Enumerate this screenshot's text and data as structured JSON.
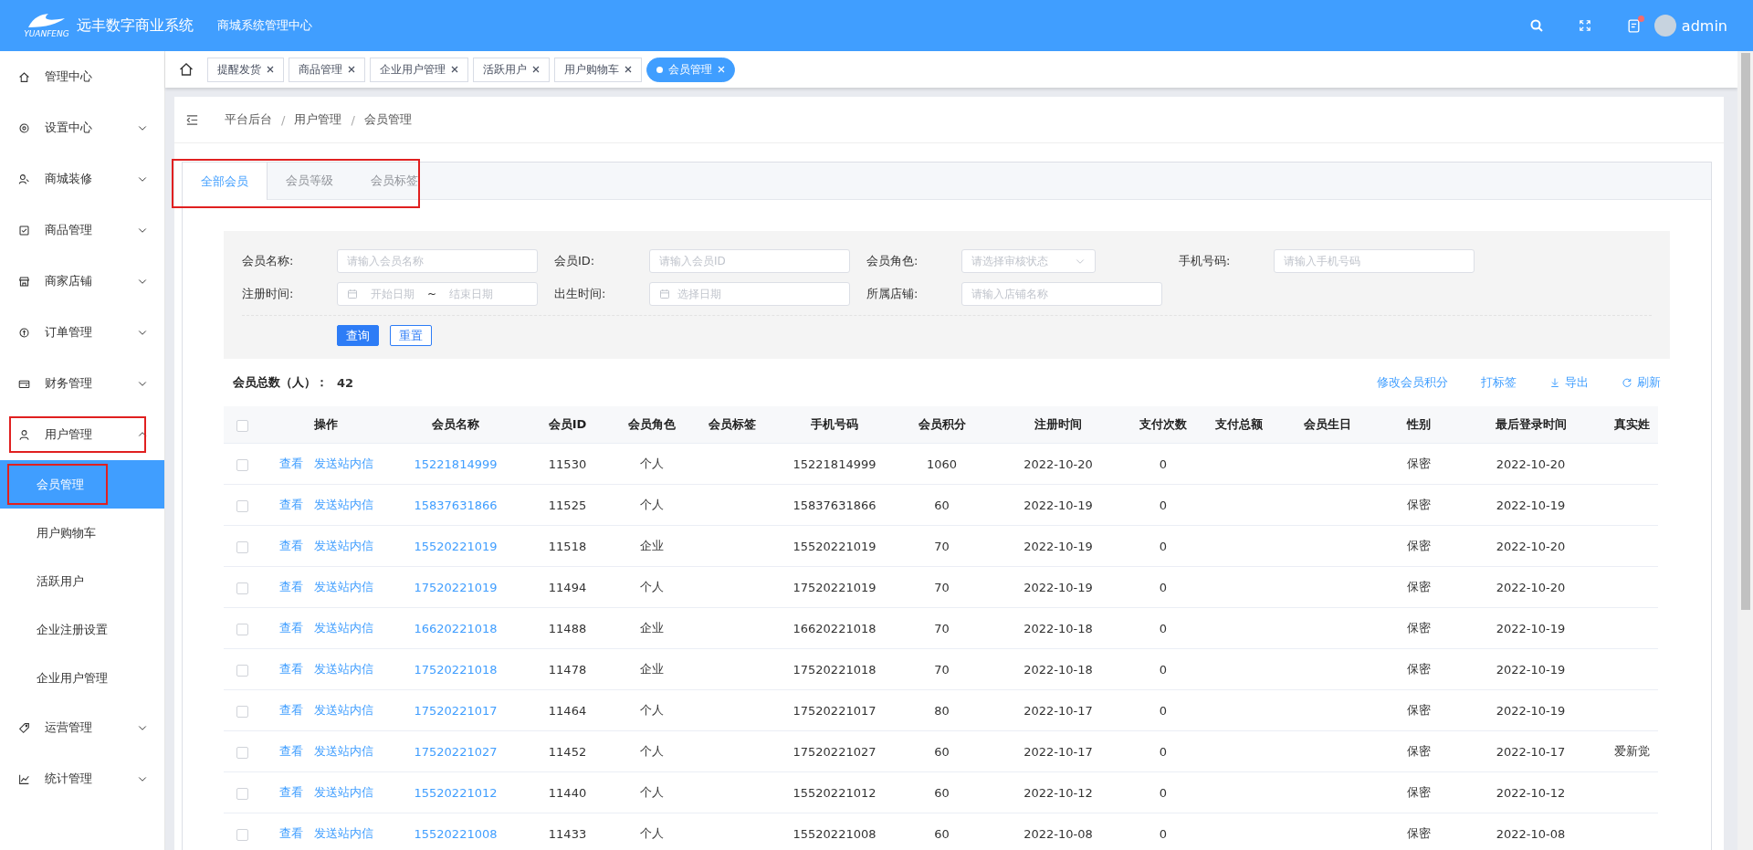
{
  "header": {
    "brand": "远丰数字商业系统",
    "brand_small": "YUANFENG",
    "subtitle": "商城系统管理中心",
    "user": "admin",
    "notification": true
  },
  "sidebar": {
    "items": [
      {
        "label": "管理中心",
        "kind": "link",
        "expanded": false,
        "highlighted": false
      },
      {
        "label": "设置中心",
        "kind": "group",
        "expanded": false,
        "highlighted": false
      },
      {
        "label": "商城装修",
        "kind": "group",
        "expanded": false,
        "highlighted": false
      },
      {
        "label": "商品管理",
        "kind": "group",
        "expanded": false,
        "highlighted": false
      },
      {
        "label": "商家店铺",
        "kind": "group",
        "expanded": false,
        "highlighted": false
      },
      {
        "label": "订单管理",
        "kind": "group",
        "expanded": false,
        "highlighted": false
      },
      {
        "label": "财务管理",
        "kind": "group",
        "expanded": false,
        "highlighted": false
      },
      {
        "label": "用户管理",
        "kind": "group",
        "expanded": true,
        "highlighted": true,
        "children": [
          {
            "label": "会员管理",
            "selected": true,
            "highlighted": true
          },
          {
            "label": "用户购物车",
            "selected": false,
            "highlighted": false
          },
          {
            "label": "活跃用户",
            "selected": false,
            "highlighted": false
          },
          {
            "label": "企业注册设置",
            "selected": false,
            "highlighted": false
          },
          {
            "label": "企业用户管理",
            "selected": false,
            "highlighted": false
          }
        ]
      },
      {
        "label": "运营管理",
        "kind": "group",
        "expanded": false,
        "highlighted": false
      },
      {
        "label": "统计管理",
        "kind": "group",
        "expanded": false,
        "highlighted": false
      }
    ]
  },
  "tag_bar": {
    "tags": [
      {
        "label": "提醒发货",
        "selected": false
      },
      {
        "label": "商品管理",
        "selected": false
      },
      {
        "label": "企业用户管理",
        "selected": false
      },
      {
        "label": "活跃用户",
        "selected": false
      },
      {
        "label": "用户购物车",
        "selected": false
      },
      {
        "label": "会员管理",
        "selected": true
      }
    ]
  },
  "breadcrumb": {
    "separator": "/",
    "items": [
      "平台后台",
      "用户管理",
      "会员管理"
    ]
  },
  "tabs": {
    "highlighted": true,
    "items": [
      {
        "label": "全部会员",
        "selected": true
      },
      {
        "label": "会员等级",
        "selected": false
      },
      {
        "label": "会员标签",
        "selected": false
      }
    ]
  },
  "filters": {
    "fields": [
      {
        "label": "会员名称:",
        "kind": "text",
        "placeholder": "请输入会员名称"
      },
      {
        "label": "会员ID:",
        "kind": "text",
        "placeholder": "请输入会员ID"
      },
      {
        "label": "会员角色:",
        "kind": "select",
        "placeholder": "请选择审核状态"
      },
      {
        "label": "手机号码:",
        "kind": "text",
        "placeholder": "请输入手机号码"
      },
      {
        "label": "注册时间:",
        "kind": "daterange",
        "placeholder": "开始日期",
        "placeholder_end": "结束日期",
        "separator": "~"
      },
      {
        "label": "出生时间:",
        "kind": "date",
        "placeholder": "选择日期"
      },
      {
        "label": "所属店铺:",
        "kind": "text",
        "placeholder": "请输入店铺名称"
      }
    ],
    "buttons": [
      {
        "label": "查询",
        "kind": "primary"
      },
      {
        "label": "重置",
        "kind": "plain"
      }
    ]
  },
  "summary": {
    "label": "会员总数（人）：",
    "value": "42"
  },
  "actions": [
    {
      "label": "修改会员积分",
      "kind": "text"
    },
    {
      "label": "打标签",
      "kind": "text"
    },
    {
      "label": "导出",
      "kind": "download"
    },
    {
      "label": "刷新",
      "kind": "refresh"
    }
  ],
  "table": {
    "select_all": false,
    "action_column": "操作",
    "columns": [
      "会员名称",
      "会员ID",
      "会员角色",
      "会员标签",
      "手机号码",
      "会员积分",
      "注册时间",
      "支付次数",
      "支付总额",
      "会员生日",
      "性别",
      "最后登录时间",
      "真实姓"
    ],
    "rows": [
      {
        "checked": false,
        "actions": [
          "查看",
          "发送站内信"
        ],
        "cells": [
          "15221814999",
          "11530",
          "个人",
          "",
          "15221814999",
          "1060",
          "2022-10-20",
          "0",
          "",
          "",
          "保密",
          "2022-10-20",
          ""
        ]
      },
      {
        "checked": false,
        "actions": [
          "查看",
          "发送站内信"
        ],
        "cells": [
          "15837631866",
          "11525",
          "个人",
          "",
          "15837631866",
          "60",
          "2022-10-19",
          "0",
          "",
          "",
          "保密",
          "2022-10-19",
          ""
        ]
      },
      {
        "checked": false,
        "actions": [
          "查看",
          "发送站内信"
        ],
        "cells": [
          "15520221019",
          "11518",
          "企业",
          "",
          "15520221019",
          "70",
          "2022-10-19",
          "0",
          "",
          "",
          "保密",
          "2022-10-20",
          ""
        ]
      },
      {
        "checked": false,
        "actions": [
          "查看",
          "发送站内信"
        ],
        "cells": [
          "17520221019",
          "11494",
          "个人",
          "",
          "17520221019",
          "70",
          "2022-10-19",
          "0",
          "",
          "",
          "保密",
          "2022-10-20",
          ""
        ]
      },
      {
        "checked": false,
        "actions": [
          "查看",
          "发送站内信"
        ],
        "cells": [
          "16620221018",
          "11488",
          "企业",
          "",
          "16620221018",
          "70",
          "2022-10-18",
          "0",
          "",
          "",
          "保密",
          "2022-10-19",
          ""
        ]
      },
      {
        "checked": false,
        "actions": [
          "查看",
          "发送站内信"
        ],
        "cells": [
          "17520221018",
          "11478",
          "企业",
          "",
          "17520221018",
          "70",
          "2022-10-18",
          "0",
          "",
          "",
          "保密",
          "2022-10-19",
          ""
        ]
      },
      {
        "checked": false,
        "actions": [
          "查看",
          "发送站内信"
        ],
        "cells": [
          "17520221017",
          "11464",
          "个人",
          "",
          "17520221017",
          "80",
          "2022-10-17",
          "0",
          "",
          "",
          "保密",
          "2022-10-19",
          ""
        ]
      },
      {
        "checked": false,
        "actions": [
          "查看",
          "发送站内信"
        ],
        "cells": [
          "17520221027",
          "11452",
          "个人",
          "",
          "17520221027",
          "60",
          "2022-10-17",
          "0",
          "",
          "",
          "保密",
          "2022-10-17",
          "爱新觉"
        ]
      },
      {
        "checked": false,
        "actions": [
          "查看",
          "发送站内信"
        ],
        "cells": [
          "15520221012",
          "11440",
          "个人",
          "",
          "15520221012",
          "60",
          "2022-10-12",
          "0",
          "",
          "",
          "保密",
          "2022-10-12",
          ""
        ]
      },
      {
        "checked": false,
        "actions": [
          "查看",
          "发送站内信"
        ],
        "cells": [
          "15520221008",
          "11433",
          "个人",
          "",
          "15520221008",
          "60",
          "2022-10-08",
          "0",
          "",
          "",
          "保密",
          "2022-10-08",
          ""
        ]
      }
    ]
  }
}
